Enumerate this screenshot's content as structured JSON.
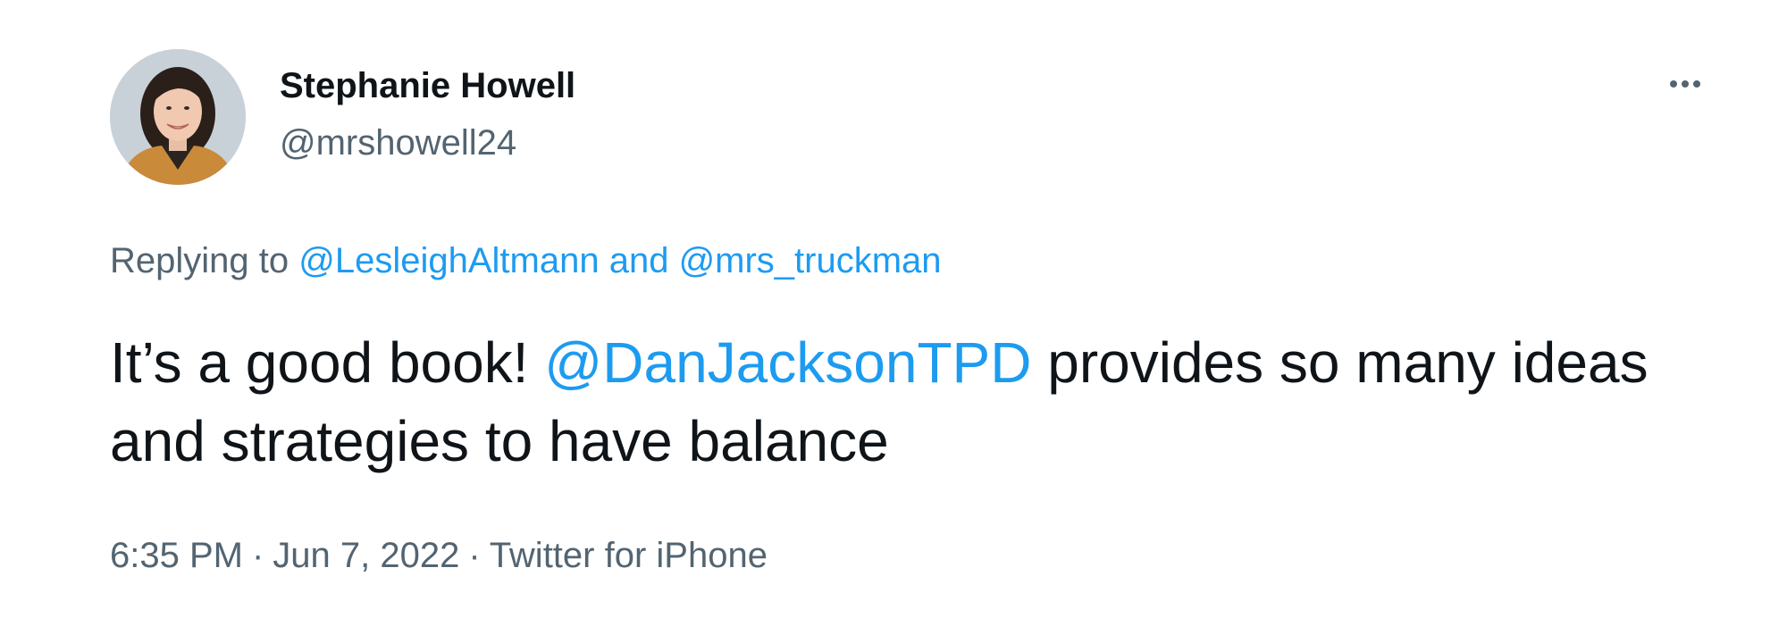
{
  "author": {
    "name": "Stephanie Howell",
    "handle": "@mrshowell24"
  },
  "reply": {
    "prefix": "Replying to ",
    "mentions": [
      "@LesleighAltmann",
      "@mrs_truckman"
    ],
    "joiner": " and "
  },
  "tweet": {
    "text_before": "It’s a good book! ",
    "mention": "@DanJacksonTPD",
    "text_after": " provides so many ideas and strategies to have balance"
  },
  "meta": {
    "time": "6:35 PM",
    "date": "Jun 7, 2022",
    "source": "Twitter for iPhone",
    "separator": "·"
  },
  "icons": {
    "more": "more-horizontal-icon"
  },
  "colors": {
    "link": "#1d9bf0",
    "secondary_text": "#536471",
    "primary_text": "#0f1419"
  }
}
